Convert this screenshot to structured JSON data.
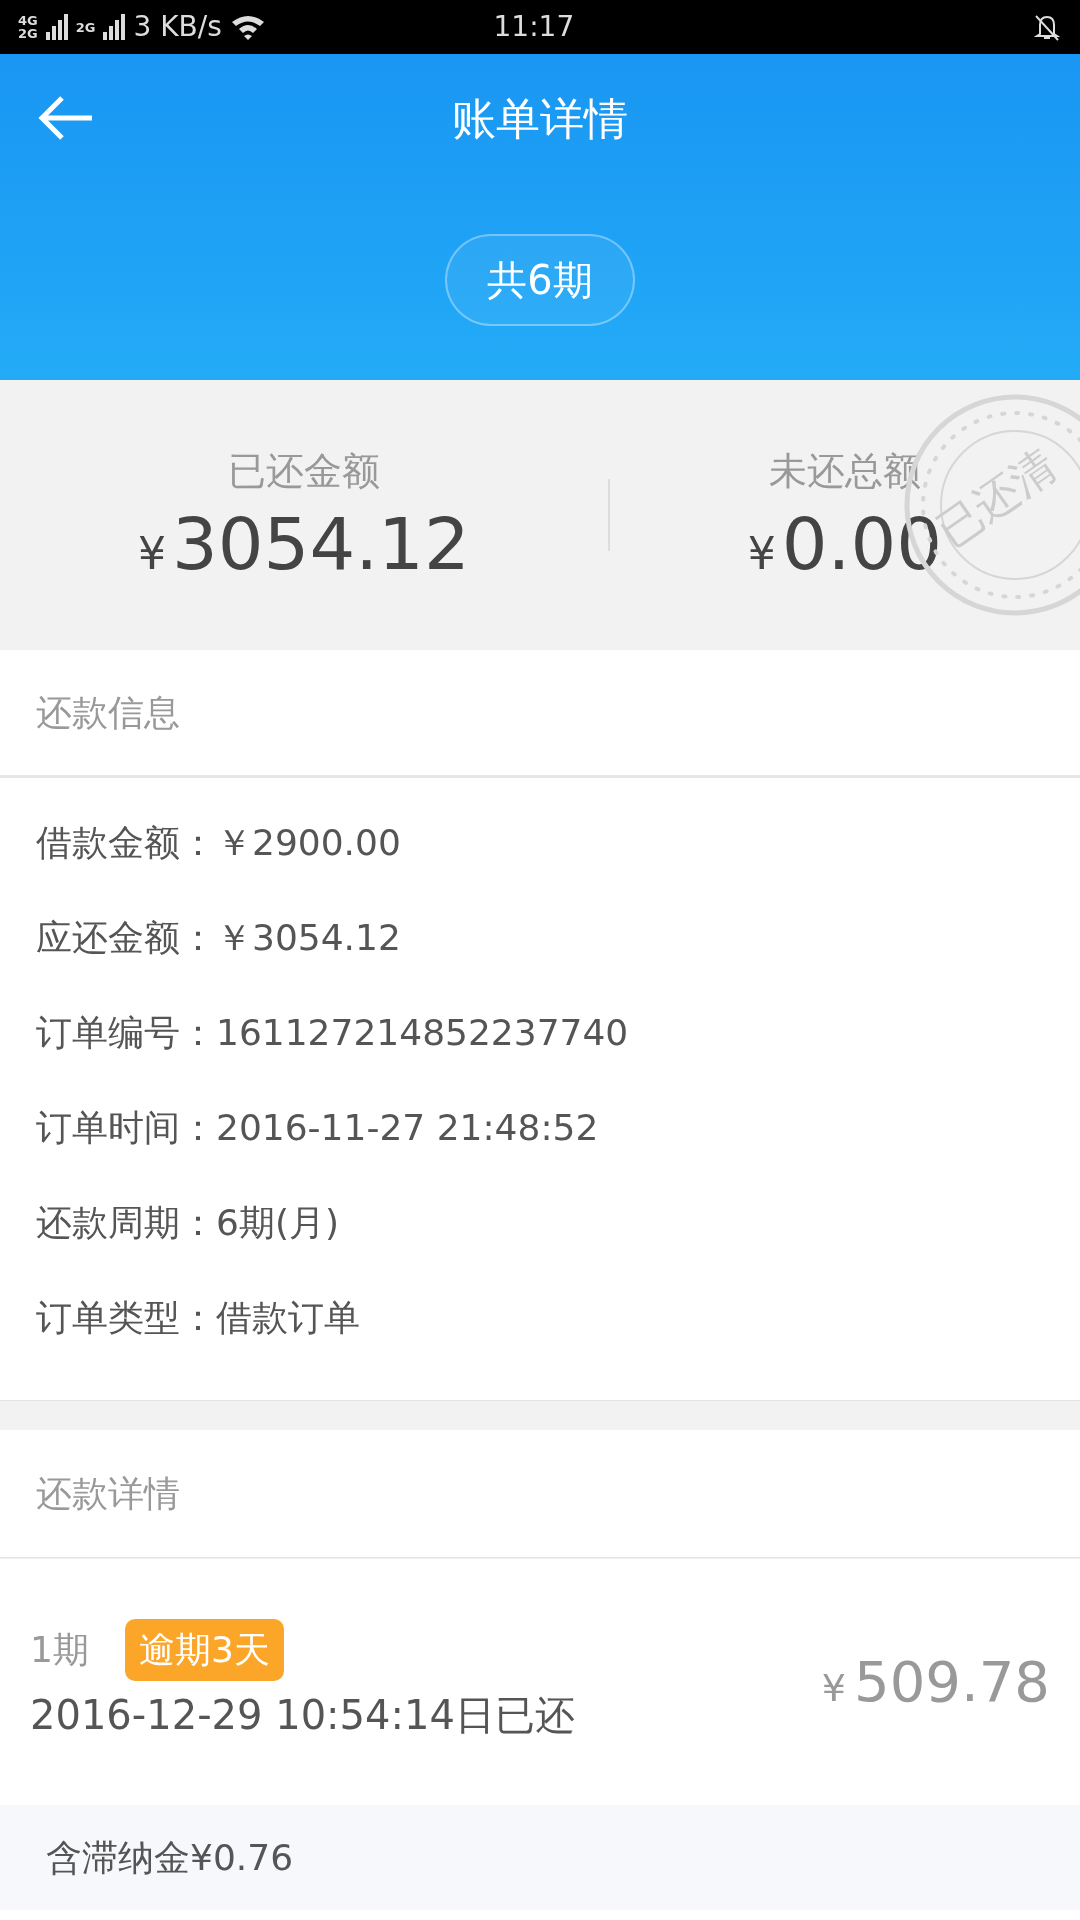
{
  "status_bar": {
    "sim_labels": [
      "4G",
      "2G",
      "2G"
    ],
    "speed": "3 KB/s",
    "time": "11:17"
  },
  "header": {
    "title": "账单详情",
    "periods": "共6期"
  },
  "summary": [
    {
      "label": "已还金额",
      "currency": "¥",
      "amount": "3054.12"
    },
    {
      "label": "未还总额",
      "currency": "¥",
      "amount": "0.00"
    }
  ],
  "stamp": {
    "text": "已还清"
  },
  "repayment_info": {
    "title": "还款信息",
    "rows": [
      {
        "label": "借款金额：",
        "value": "￥2900.00"
      },
      {
        "label": "应还金额：",
        "value": "￥3054.12"
      },
      {
        "label": "订单编号：",
        "value": "161127214852237740"
      },
      {
        "label": "订单时间：",
        "value": "2016-11-27 21:48:52"
      },
      {
        "label": "还款周期：",
        "value": "6期(月)"
      },
      {
        "label": "订单类型：",
        "value": "借款订单"
      }
    ]
  },
  "repayment_details": {
    "title": "还款详情",
    "items": [
      {
        "period": "1期",
        "tag": "逾期3天",
        "paid_at": "2016-12-29 10:54:14日已还",
        "currency": "¥",
        "amount": "509.78",
        "late_fee": "含滞纳金¥0.76"
      }
    ]
  }
}
